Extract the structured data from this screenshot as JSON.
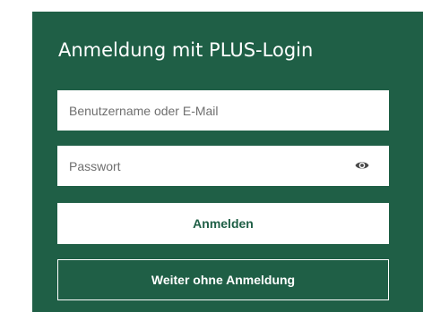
{
  "login": {
    "title": "Anmeldung mit PLUS-Login",
    "username": {
      "placeholder": "Benutzername oder E-Mail",
      "value": ""
    },
    "password": {
      "placeholder": "Passwort",
      "value": "",
      "toggle_icon": "eye-icon"
    },
    "login_button_label": "Anmelden",
    "guest_button_label": "Weiter ohne Anmeldung"
  },
  "colors": {
    "panel_background": "#1f5f46",
    "button_text": "#1f5f46",
    "field_background": "#ffffff"
  }
}
